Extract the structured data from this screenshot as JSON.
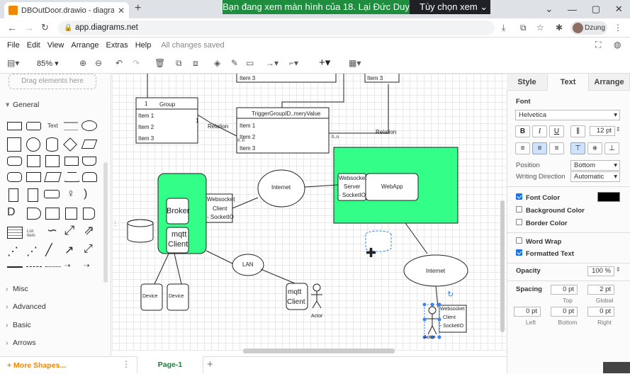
{
  "browser": {
    "tab_title": "DBOutDoor.drawio - diagrams.ne",
    "share_banner": "Bạn đang xem màn hình của 18. Lại Đức Duy",
    "share_options": "Tùy chọn xem",
    "url": "app.diagrams.net",
    "profile_name": "Dzung"
  },
  "menu": {
    "items": [
      "File",
      "Edit",
      "View",
      "Arrange",
      "Extras",
      "Help"
    ],
    "status": "All changes saved"
  },
  "toolbar": {
    "zoom": "85%"
  },
  "left_panel": {
    "drag_hint": "Drag elements here",
    "general": "General",
    "shape_text": "Text",
    "list_label": "List Item",
    "sections": [
      "Misc",
      "Advanced",
      "Basic",
      "Arrows"
    ],
    "more_shapes": "+ More Shapes..."
  },
  "pages": {
    "current": "Page-1"
  },
  "diagram": {
    "item1": "Item 1",
    "item2": "Item 2",
    "item3": "Item 3",
    "group": "Group",
    "trigger": "TriggerGroupID..meryValue",
    "relation": "Relation",
    "c0n": "0..n",
    "one": "1",
    "internet": "Internet",
    "websocket": "Websocket",
    "server": "Server",
    "socketio": "- SocketIO",
    "webapp": "WebApp",
    "broker": "Broker",
    "mqtt": "mqtt",
    "client": "Client",
    "socketio2": "- SocketIO",
    "lan": "LAN",
    "device": "Device",
    "actor": "Actor"
  },
  "right_panel": {
    "tabs": [
      "Style",
      "Text",
      "Arrange"
    ],
    "font_title": "Font",
    "font_name": "Helvetica",
    "font_size": "12 pt",
    "position_label": "Position",
    "position_value": "Bottom",
    "writing_label": "Writing Direction",
    "writing_value": "Automatic",
    "font_color": "Font Color",
    "background_color": "Background Color",
    "border_color": "Border Color",
    "word_wrap": "Word Wrap",
    "formatted_text": "Formatted Text",
    "opacity_label": "Opacity",
    "opacity_value": "100 %",
    "spacing_label": "Spacing",
    "spacing_top": "0 pt",
    "spacing_global": "2 pt",
    "top": "Top",
    "global": "Global",
    "spacing_left": "0 pt",
    "spacing_bottom": "0 pt",
    "spacing_right": "0 pt",
    "left": "Left",
    "bottom": "Bottom",
    "right": "Right"
  },
  "colors": {
    "accent_green": "#33ff88",
    "brand_orange": "#f08705",
    "share_green": "#1e8e3e"
  }
}
